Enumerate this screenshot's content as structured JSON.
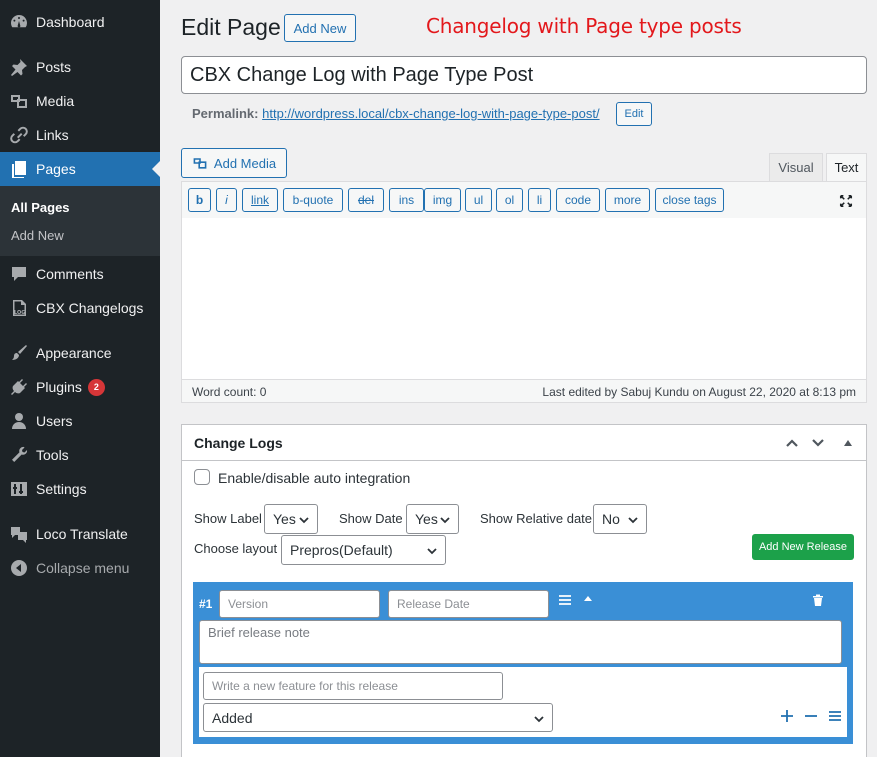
{
  "sidebar": {
    "items": [
      {
        "label": "Dashboard",
        "icon": "dashboard-icon"
      },
      {
        "label": "Posts",
        "icon": "pin-icon"
      },
      {
        "label": "Media",
        "icon": "media-icon"
      },
      {
        "label": "Links",
        "icon": "link-icon"
      },
      {
        "label": "Pages",
        "icon": "pages-icon"
      },
      {
        "label": "Comments",
        "icon": "comment-icon"
      },
      {
        "label": "CBX Changelogs",
        "icon": "log-icon"
      },
      {
        "label": "Appearance",
        "icon": "brush-icon"
      },
      {
        "label": "Plugins",
        "icon": "plugin-icon",
        "badge": "2"
      },
      {
        "label": "Users",
        "icon": "user-icon"
      },
      {
        "label": "Tools",
        "icon": "wrench-icon"
      },
      {
        "label": "Settings",
        "icon": "settings-icon"
      },
      {
        "label": "Loco Translate",
        "icon": "translate-icon"
      },
      {
        "label": "Collapse menu",
        "icon": "collapse-icon"
      }
    ],
    "submenu": [
      "All Pages",
      "Add New"
    ]
  },
  "header": {
    "title": "Edit Page",
    "add_new": "Add New",
    "annotation": "Changelog with Page type posts"
  },
  "post": {
    "title": "CBX Change Log with Page Type Post",
    "permalink_label": "Permalink:",
    "permalink_base": "http://wordpress.local/",
    "permalink_slug": "cbx-change-log-with-page-type-post/",
    "edit_button": "Edit"
  },
  "editor": {
    "add_media": "Add Media",
    "tabs": [
      "Visual",
      "Text"
    ],
    "quicktags": [
      "b",
      "i",
      "link",
      "b-quote",
      "del",
      "ins",
      "img",
      "ul",
      "ol",
      "li",
      "code",
      "more",
      "close tags"
    ],
    "word_count": "Word count: 0",
    "last_edited": "Last edited by Sabuj Kundu on August 22, 2020 at 8:13 pm"
  },
  "changelogs": {
    "title": "Change Logs",
    "auto_integration": "Enable/disable auto integration",
    "show_label": "Show Label",
    "show_label_value": "Yes",
    "show_date": "Show Date",
    "show_date_value": "Yes",
    "show_relative": "Show Relative date",
    "show_relative_value": "No",
    "choose_layout": "Choose layout",
    "layout_value": "Prepros(Default)",
    "add_release": "Add New Release",
    "release": {
      "number": "#1",
      "version_placeholder": "Version",
      "date_placeholder": "Release Date",
      "note_placeholder": "Brief release note",
      "feature_placeholder": "Write a new feature for this release",
      "feature_type": "Added"
    }
  },
  "colors": {
    "sidebar_bg": "#1d2327",
    "accent": "#2271b1",
    "annotation": "#e3181c",
    "release_bg": "#3a8fd6",
    "add_release_bg": "#1ca14a"
  }
}
